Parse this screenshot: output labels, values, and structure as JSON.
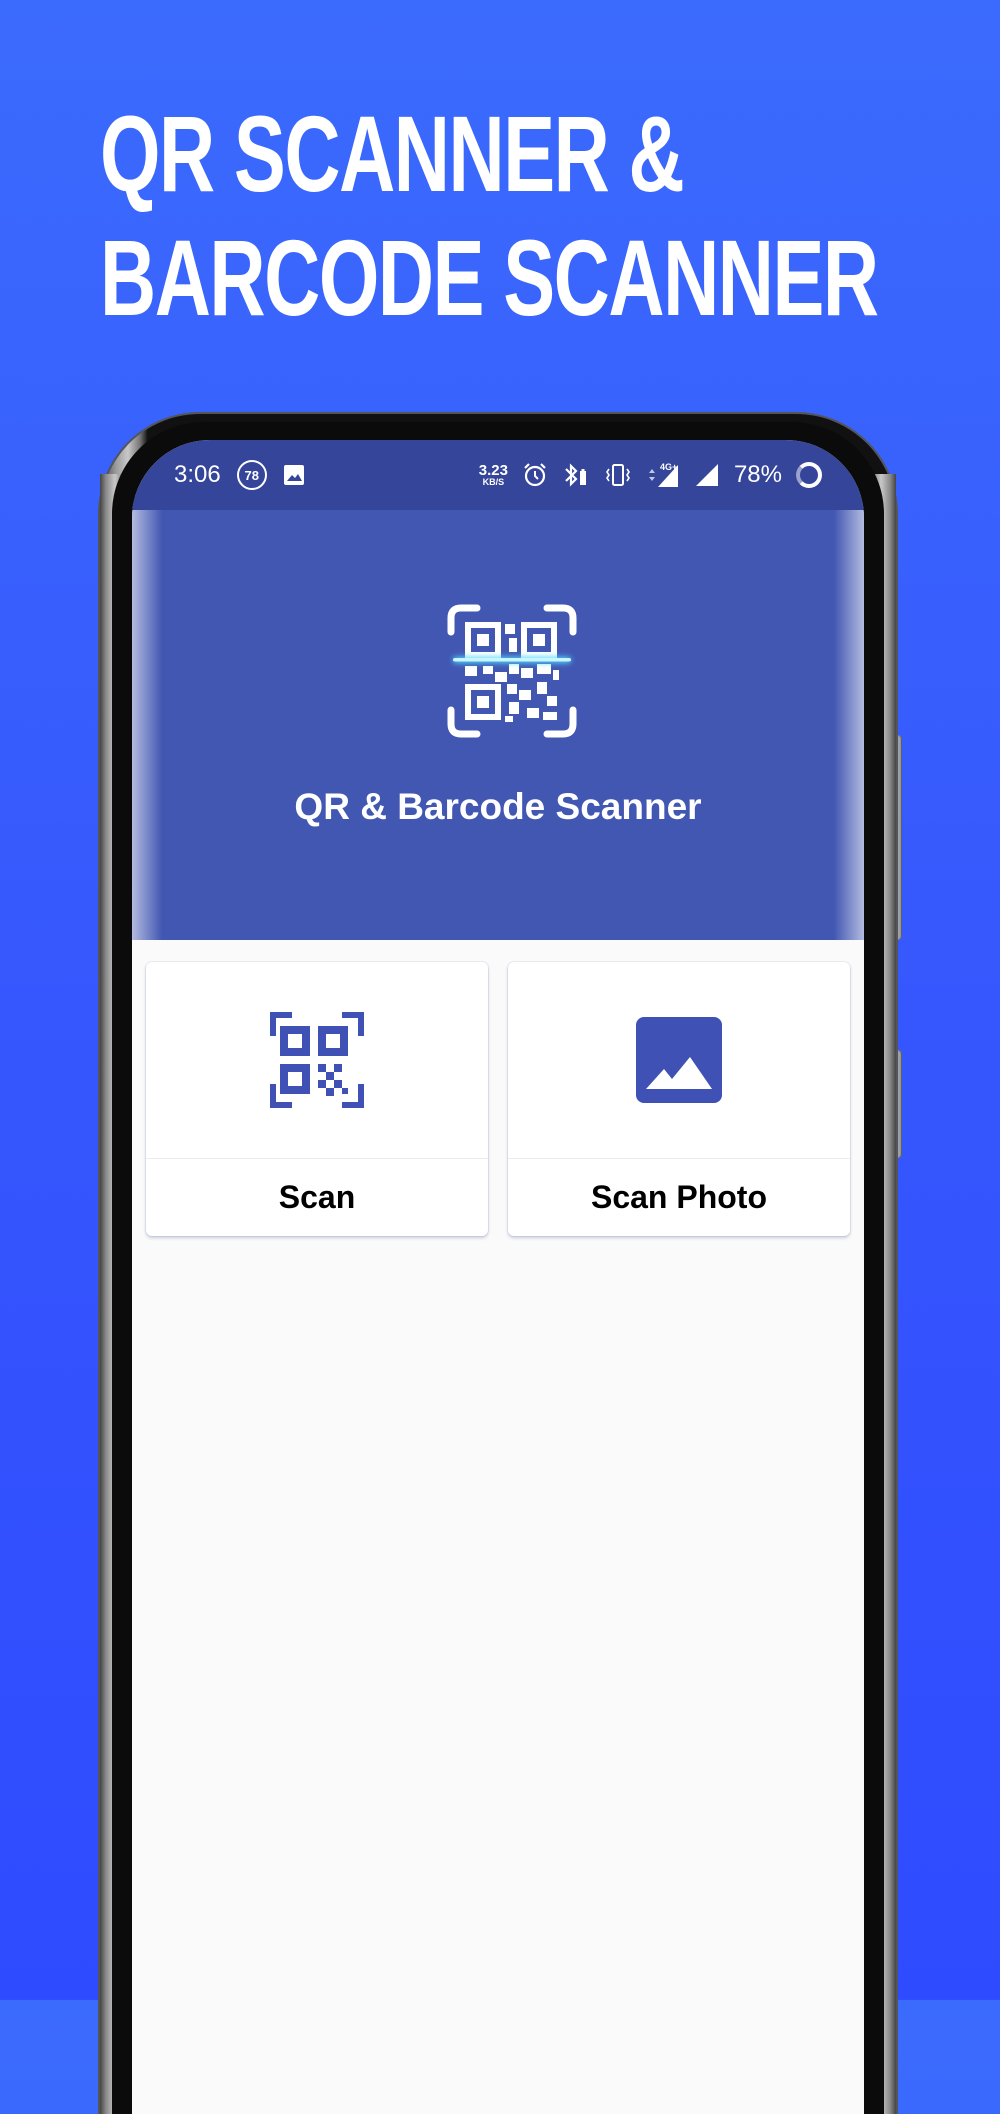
{
  "promo": {
    "headline_line1": "QR SCANNER &",
    "headline_line2": "BARCODE SCANNER"
  },
  "status_bar": {
    "time": "3:06",
    "notification_badge": "78",
    "network_speed_value": "3.23",
    "network_speed_unit": "KB/S",
    "network_type": "4G+",
    "battery_percent": "78%",
    "icons": [
      "data-badge-icon",
      "image-notification-icon",
      "alarm-icon",
      "bluetooth-battery-icon",
      "vibrate-icon",
      "signal-4g-icon",
      "signal-icon",
      "battery-ring-icon"
    ]
  },
  "app": {
    "title": "QR & Barcode Scanner",
    "logo_icon": "qr-scan-logo-icon"
  },
  "actions": [
    {
      "label": "Scan",
      "icon": "qr-code-icon"
    },
    {
      "label": "Scan Photo",
      "icon": "image-icon"
    }
  ],
  "colors": {
    "background": "#3657fd",
    "header": "#4257b2",
    "status_bar": "#34459a",
    "accent": "#3f51b5",
    "scan_line": "#4fd8ff"
  }
}
